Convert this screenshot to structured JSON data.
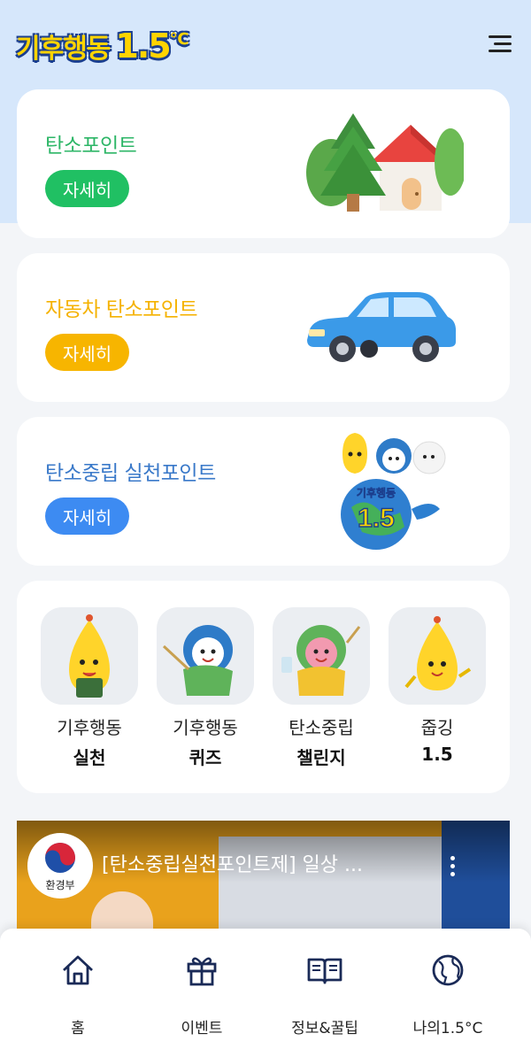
{
  "header": {
    "logo_text": "기후행동",
    "logo_number": "1.5",
    "logo_unit": "℃"
  },
  "cards": [
    {
      "title": "탄소포인트",
      "button": "자세히",
      "color": "#2db667",
      "button_color": "#20c063",
      "illustration": "house-trees-illustration"
    },
    {
      "title": "자동차 탄소포인트",
      "button": "자세히",
      "color": "#f5b200",
      "button_color": "#f7b500",
      "illustration": "blue-car-illustration"
    },
    {
      "title": "탄소중립 실천포인트",
      "button": "자세히",
      "color": "#3a79c9",
      "button_color": "#3d8bf2",
      "illustration": "mascots-globe-illustration"
    }
  ],
  "quick_menu": [
    {
      "line1": "기후행동",
      "line2": "실천"
    },
    {
      "line1": "기후행동",
      "line2": "퀴즈"
    },
    {
      "line1": "탄소중립",
      "line2": "챌린지"
    },
    {
      "line1": "줍깅",
      "line2": "1.5"
    }
  ],
  "video": {
    "channel_label": "환경부",
    "title": "[탄소중립실천포인트제] 일상 ..."
  },
  "bottom_nav": [
    {
      "label": "홈",
      "icon": "home-icon"
    },
    {
      "label": "이벤트",
      "icon": "gift-icon"
    },
    {
      "label": "정보&꿀팁",
      "icon": "book-icon"
    },
    {
      "label": "나의1.5°C",
      "icon": "globe-icon"
    }
  ]
}
